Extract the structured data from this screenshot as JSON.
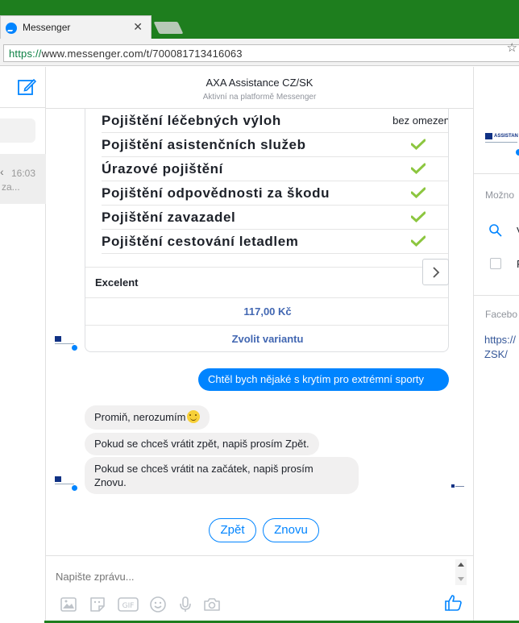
{
  "browser": {
    "tab_title": "Messenger",
    "tab_close": "✕",
    "url_scheme": "https://",
    "url_rest": "www.messenger.com/t/700081713416063"
  },
  "sidebar": {
    "conversation_time": "16:03",
    "conversation_snippet": "za..."
  },
  "header": {
    "title": "AXA Assistance CZ/SK",
    "subtitle": "Aktivní na platformě Messenger"
  },
  "card": {
    "coverage": [
      {
        "name": "Pojištění léčebných výloh",
        "value": "bez omezen",
        "check": false
      },
      {
        "name": "Pojištění asistenčních služeb",
        "value": "",
        "check": true
      },
      {
        "name": "Úrazové pojištění",
        "value": "",
        "check": true
      },
      {
        "name": "Pojištění odpovědnosti za škodu",
        "value": "",
        "check": true
      },
      {
        "name": "Pojištění zavazadel",
        "value": "",
        "check": true
      },
      {
        "name": "Pojištění cestování letadlem",
        "value": "",
        "check": true
      }
    ],
    "plan_name": "Excelent",
    "price": "117,00 Kč",
    "choose_label": "Zvolit variantu",
    "check_color": "#8cc63f"
  },
  "messages": {
    "outgoing_1": "Chtěl bych nějaké s krytím pro extrémní sporty",
    "incoming_1": "Promiň, nerozumím",
    "incoming_2": "Pokud se chceš vrátit zpět, napiš prosím Zpět.",
    "incoming_3_line1": "Pokud se chceš vrátit na začátek, napiš prosím",
    "incoming_3_line2": "Znovu."
  },
  "quick_replies": {
    "back": "Zpět",
    "again": "Znovu"
  },
  "composer": {
    "placeholder": "Napište zprávu..."
  },
  "right_panel": {
    "brand_text": "ASSISTAN",
    "options_label": "Možno",
    "option_search": "V",
    "option_2": "F",
    "facebook_label": "Facebo",
    "link": "https://ZSK/"
  },
  "colors": {
    "messenger_blue": "#0084ff",
    "browser_green": "#1e7e1e",
    "link_blue": "#4267b2"
  }
}
